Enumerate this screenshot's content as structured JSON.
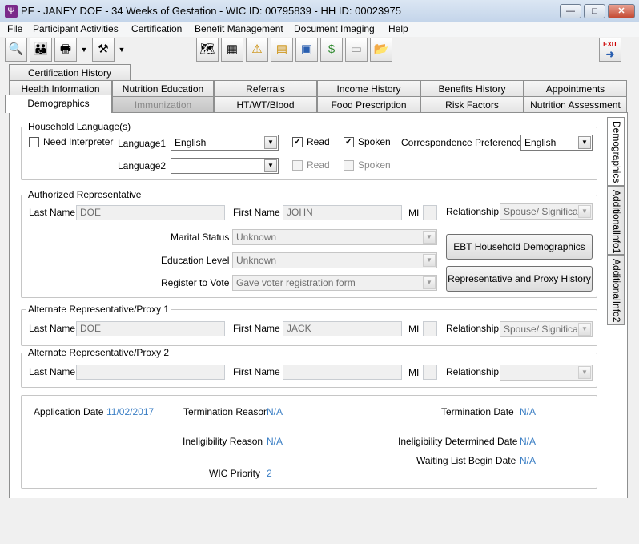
{
  "window": {
    "title": "PF - JANEY DOE - 34 Weeks of Gestation - WIC ID: 00795839 - HH ID: 00023975",
    "minimize": "—",
    "maximize": "□",
    "close": "✕"
  },
  "menu": [
    {
      "label": "File"
    },
    {
      "label": "Participant Activities"
    },
    {
      "label": "Certification"
    },
    {
      "label": "Benefit Management"
    },
    {
      "label": "Document Imaging"
    },
    {
      "label": "Help"
    }
  ],
  "toolbar": {
    "exit_label": "EXIT",
    "icons": [
      "search-icon",
      "family-icon",
      "printer-icon",
      "tools-icon",
      "map-icon",
      "calendar-icon",
      "alert-icon",
      "note-icon",
      "form-icon",
      "money-icon",
      "card-icon",
      "folder-icon"
    ]
  },
  "tabs": {
    "row1": [
      {
        "label": "Certification History"
      }
    ],
    "row2": [
      {
        "label": "Health Information"
      },
      {
        "label": "Nutrition Education"
      },
      {
        "label": "Referrals"
      },
      {
        "label": "Income History"
      },
      {
        "label": "Benefits History"
      },
      {
        "label": "Appointments"
      }
    ],
    "row3": [
      {
        "label": "Demographics"
      },
      {
        "label": "Immunization"
      },
      {
        "label": "HT/WT/Blood"
      },
      {
        "label": "Food Prescription"
      },
      {
        "label": "Risk Factors"
      },
      {
        "label": "Nutrition Assessment"
      }
    ]
  },
  "side_tabs": [
    {
      "label": "Demographics"
    },
    {
      "label": "AdditionalInfo1"
    },
    {
      "label": "AdditionalInfo2"
    }
  ],
  "household_language": {
    "group_label": "Household Language(s)",
    "need_interpreter_label": "Need Interpreter",
    "need_interpreter_checked": false,
    "language1_label": "Language1",
    "language1_value": "English",
    "read1_label": "Read",
    "read1_mark": "✓",
    "spoken1_label": "Spoken",
    "spoken1_mark": "✓",
    "correspondence_label": "Correspondence Preference",
    "correspondence_value": "English",
    "language2_label": "Language2",
    "language2_value": "",
    "read2_label": "Read",
    "spoken2_label": "Spoken"
  },
  "authorized_rep": {
    "group_label": "Authorized Representative",
    "last_name_label": "Last Name",
    "last_name_value": "DOE",
    "first_name_label": "First Name",
    "first_name_value": "JOHN",
    "mi_label": "MI",
    "mi_value": "",
    "relationship_label": "Relationship",
    "relationship_value": "Spouse/ Significant",
    "marital_status_label": "Marital Status",
    "marital_status_value": "Unknown",
    "education_label": "Education Level",
    "education_value": "Unknown",
    "register_label": "Register to Vote",
    "register_value": "Gave voter registration form",
    "ebt_button": "EBT Household Demographics",
    "proxy_history_button": "Representative and Proxy History"
  },
  "alt_proxy1": {
    "group_label": "Alternate Representative/Proxy 1",
    "last_name_label": "Last Name",
    "last_name_value": "DOE",
    "first_name_label": "First Name",
    "first_name_value": "JACK",
    "mi_label": "MI",
    "mi_value": "",
    "relationship_label": "Relationship",
    "relationship_value": "Spouse/ Significant"
  },
  "alt_proxy2": {
    "group_label": "Alternate Representative/Proxy 2",
    "last_name_label": "Last Name",
    "last_name_value": "",
    "first_name_label": "First Name",
    "first_name_value": "",
    "mi_label": "MI",
    "mi_value": "",
    "relationship_label": "Relationship",
    "relationship_value": ""
  },
  "status_info": {
    "application_date_label": "Application Date",
    "application_date_value": "11/02/2017",
    "termination_reason_label": "Termination Reason",
    "termination_reason_value": "N/A",
    "termination_date_label": "Termination Date",
    "termination_date_value": "N/A",
    "ineligibility_reason_label": "Ineligibility Reason",
    "ineligibility_reason_value": "N/A",
    "ineligibility_determined_label": "Ineligibility Determined Date",
    "ineligibility_determined_value": "N/A",
    "waiting_list_label": "Waiting List Begin Date",
    "waiting_list_value": "N/A",
    "wic_priority_label": "WIC Priority",
    "wic_priority_value": "2"
  }
}
